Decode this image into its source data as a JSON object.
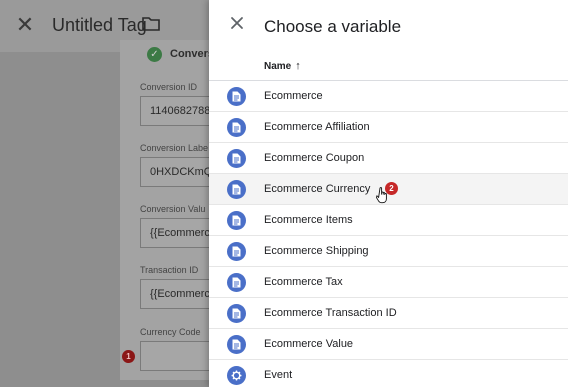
{
  "editor": {
    "title": "Untitled Tag",
    "close_icon": "close-icon",
    "folder_icon": "folder-icon",
    "section_heading": "Convers",
    "fields": [
      {
        "label": "Conversion ID",
        "value": "1140682788"
      },
      {
        "label": "Conversion Labe",
        "value": "0HXDCKmQ"
      },
      {
        "label": "Conversion Valu",
        "value": "{{Ecommerc"
      },
      {
        "label": "Transaction ID",
        "value": "{{Ecommerc"
      },
      {
        "label": "Currency Code",
        "value": ""
      }
    ],
    "step_marker": "1"
  },
  "picker": {
    "title": "Choose a variable",
    "column_header": "Name",
    "sort_icon": "arrow-up-icon",
    "step_marker": "2",
    "items": [
      {
        "label": "Ecommerce",
        "icon": "document-icon"
      },
      {
        "label": "Ecommerce Affiliation",
        "icon": "document-icon"
      },
      {
        "label": "Ecommerce Coupon",
        "icon": "document-icon"
      },
      {
        "label": "Ecommerce Currency",
        "icon": "document-icon"
      },
      {
        "label": "Ecommerce Items",
        "icon": "document-icon"
      },
      {
        "label": "Ecommerce Shipping",
        "icon": "document-icon"
      },
      {
        "label": "Ecommerce Tax",
        "icon": "document-icon"
      },
      {
        "label": "Ecommerce Transaction ID",
        "icon": "document-icon"
      },
      {
        "label": "Ecommerce Value",
        "icon": "document-icon"
      },
      {
        "label": "Event",
        "icon": "gear-icon"
      }
    ]
  },
  "colors": {
    "icon_blue": "#4a6fc8",
    "marker_red": "#c62828",
    "check_green": "#3c7a45"
  }
}
